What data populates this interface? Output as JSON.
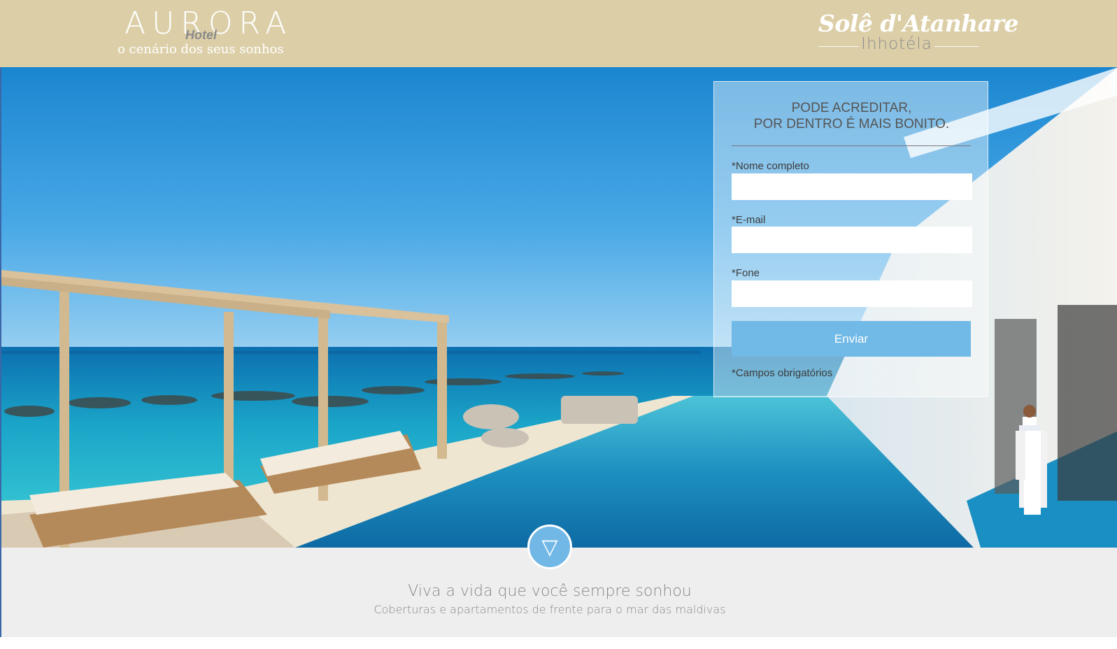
{
  "header": {
    "logo_left": {
      "title": "AURORA",
      "overlay": "Hotel",
      "tagline": "o cenário dos seus sonhos"
    },
    "logo_right": {
      "script": "Solê d'Atanhare",
      "subtitle": "Ihhotéla"
    }
  },
  "hero": {
    "image": "resort-pool-ocean-view"
  },
  "form": {
    "heading_line1": "PODE ACREDITAR,",
    "heading_line2": "POR DENTRO É MAIS BONITO.",
    "fields": [
      {
        "label": "*Nome completo",
        "value": ""
      },
      {
        "label": "*E-mail",
        "value": ""
      },
      {
        "label": "*Fone",
        "value": ""
      }
    ],
    "submit_label": "Enviar",
    "required_note": "*Campos obrigatórios"
  },
  "bottom": {
    "scroll_icon": "▽",
    "title": "Viva a vida que você sempre sonhou",
    "subtitle": "Coberturas e apartamentos de frente para o mar das maldivas"
  },
  "colors": {
    "header_bg": "#dccfa8",
    "button_blue": "#71b9e6",
    "bottom_bg": "#eeeeee"
  }
}
